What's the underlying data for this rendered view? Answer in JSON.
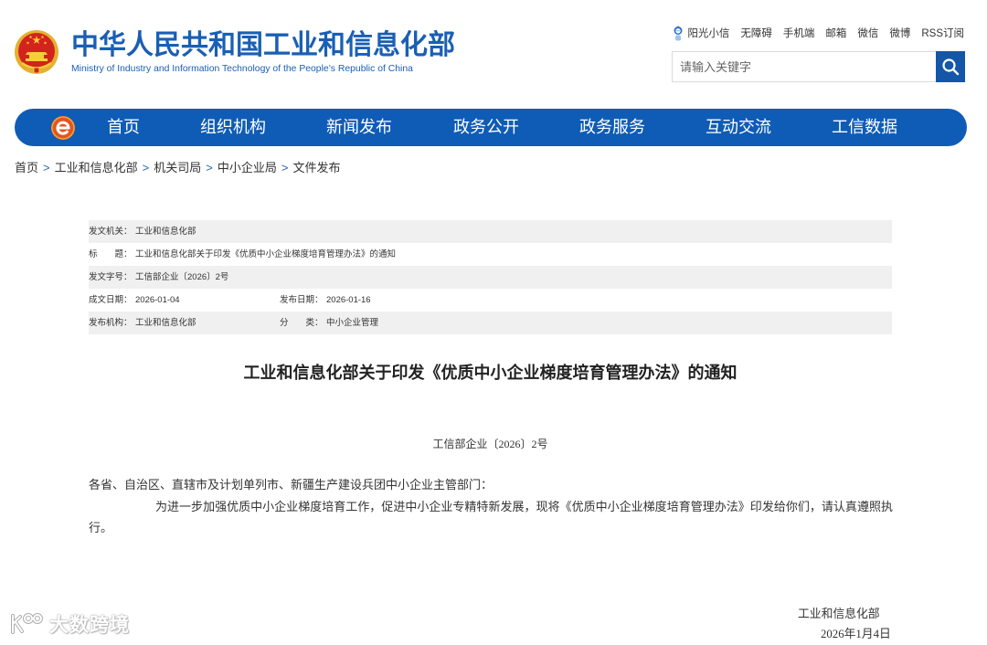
{
  "colors": {
    "brand_blue": "#1a5fb4",
    "nav_blue": "#0f5cb6",
    "search_button": "#1457a8",
    "meta_row_gray": "#f0f0f0",
    "breadcrumb_separator": "#2a64b8"
  },
  "header": {
    "emblem_icon": "national-emblem-icon",
    "title_cn": "中华人民共和国工业和信息化部",
    "title_en": "Ministry of Industry and Information Technology of the People’s Republic of China",
    "top_links_icon": "robot-mascot-icon",
    "top_links": [
      "阳光小信",
      "无障碍",
      "手机端",
      "邮箱",
      "微信",
      "微博",
      "RSS订阅"
    ],
    "search": {
      "placeholder": "请输入关键字",
      "value": "",
      "icon": "search-icon"
    }
  },
  "nav": {
    "logo_icon": "miit-logo-icon",
    "items": [
      "首页",
      "组织机构",
      "新闻发布",
      "政务公开",
      "政务服务",
      "互动交流",
      "工信数据"
    ]
  },
  "breadcrumb": {
    "separator": ">",
    "items": [
      "首页",
      "工业和信息化部",
      "机关司局",
      "中小企业局",
      "文件发布"
    ]
  },
  "meta": {
    "issuer": {
      "label": "发文机关：",
      "value": "工业和信息化部"
    },
    "title": {
      "label": "标　　题：",
      "value": "工业和信息化部关于印发《优质中小企业梯度培育管理办法》的通知"
    },
    "doc_no": {
      "label": "发文字号：",
      "value": "工信部企业〔2026〕2号"
    },
    "written_date": {
      "label": "成文日期：",
      "value": "2026-01-04"
    },
    "publish_date": {
      "label": "发布日期：",
      "value": "2026-01-16"
    },
    "publisher": {
      "label": "发布机构：",
      "value": "工业和信息化部"
    },
    "category": {
      "label": "分　　类：",
      "value": "中小企业管理"
    }
  },
  "document": {
    "title": "工业和信息化部关于印发《优质中小企业梯度培育管理办法》的通知",
    "doc_number": "工信部企业〔2026〕2号",
    "salutation": "各省、自治区、直辖市及计划单列市、新疆生产建设兵团中小企业主管部门：",
    "body": [
      "为进一步加强优质中小企业梯度培育工作，促进中小企业专精特新发展，现将《优质中小企业梯度培育管理办法》印发给你们，请认真遵照执行。"
    ],
    "signature": {
      "org": "工业和信息化部",
      "date": "2026年1月4日"
    }
  },
  "watermark": {
    "icon": "watermark-logo-icon",
    "text": "大数跨境"
  }
}
